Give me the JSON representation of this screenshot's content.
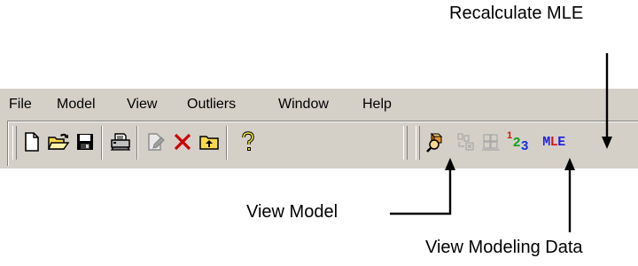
{
  "callouts": {
    "recalculate": "Recalculate MLE",
    "view_model": "View Model",
    "view_modeling_data": "View Modeling Data"
  },
  "menu": [
    {
      "label": "File"
    },
    {
      "label": "Model"
    },
    {
      "label": "View"
    },
    {
      "label": "Outliers"
    },
    {
      "label": "Window"
    },
    {
      "label": "Help"
    }
  ],
  "toolbar": {
    "new_icon": "new-document-icon",
    "open_icon": "open-folder-icon",
    "save_icon": "save-disk-icon",
    "print_icon": "printer-icon",
    "edit_icon": "edit-document-icon",
    "delete_icon": "delete-x-icon",
    "up_icon": "up-folder-icon",
    "help_icon": "help-question-icon",
    "view_model_icon": "view-model-icon",
    "transform_icon": "transform-icon",
    "group_icon": "group-boxes-icon",
    "view_data_digits": {
      "one": "1",
      "two": "2",
      "three": "3"
    },
    "mle_label": "MLE"
  },
  "colors": {
    "window_bg": "#d4d0c8",
    "delete_red": "#cc0000",
    "mle_blue": "#1f1fe0",
    "mle_red": "#e01010",
    "digit_red": "#e01010",
    "digit_green": "#10a020",
    "digit_blue": "#1030e0"
  }
}
